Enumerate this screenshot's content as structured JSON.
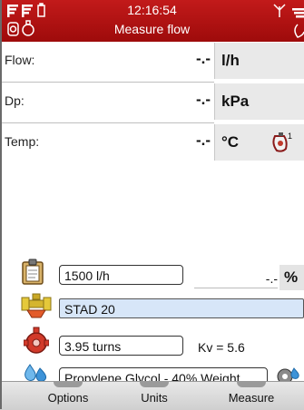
{
  "header": {
    "time": "12:16:54",
    "title": "Measure flow",
    "left_icons": [
      "signal-icon",
      "signal-icon",
      "battery-icon",
      "sensor-icon",
      "valve-icon"
    ],
    "right_icons": [
      "antenna-icon",
      "signal-icon",
      "valve-icon"
    ],
    "color": "#b51414"
  },
  "measurements": [
    {
      "label": "Flow:",
      "value": "-.-",
      "unit": "l/h"
    },
    {
      "label": "Dp:",
      "value": "-.-",
      "unit": "kPa"
    },
    {
      "label": "Temp:",
      "value": "-.-",
      "unit": "°C",
      "unit_icon": "temperature-sensor-icon",
      "unit_icon_badge": "1"
    }
  ],
  "design_flow": {
    "icon": "clipboard-icon",
    "value": "1500 l/h",
    "percent_value": "-.-",
    "percent_unit": "%"
  },
  "valve": {
    "icon": "valve-type-icon",
    "value": "STAD 20"
  },
  "presetting": {
    "icon": "handwheel-icon",
    "value": "3.95 turns",
    "kv_text": "Kv = 5.6"
  },
  "medium": {
    "icon": "water-drops-icon",
    "value": "Propylene Glycol - 40% Weight",
    "right_icon": "medium-settings-icon"
  },
  "tabs": [
    {
      "label": "Options"
    },
    {
      "label": "Units"
    },
    {
      "label": "Measure"
    }
  ]
}
